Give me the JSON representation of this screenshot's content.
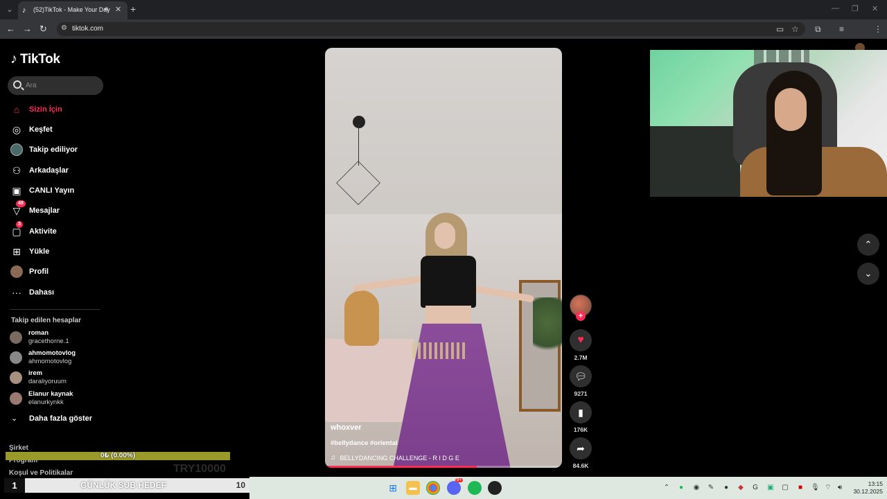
{
  "browser": {
    "tab_title": "(52)TikTok - Make Your Day",
    "url": "tiktok.com"
  },
  "sidebar": {
    "logo": "TikTok",
    "search_placeholder": "Ara",
    "nav": [
      {
        "label": "Sizin İçin",
        "icon": "home-icon",
        "active": true
      },
      {
        "label": "Keşfet",
        "icon": "compass-icon"
      },
      {
        "label": "Takip ediliyor",
        "icon": "following-avatar"
      },
      {
        "label": "Arkadaşlar",
        "icon": "friends-icon"
      },
      {
        "label": "CANLI Yayın",
        "icon": "live-icon"
      },
      {
        "label": "Mesajlar",
        "icon": "message-icon",
        "badge": "49"
      },
      {
        "label": "Aktivite",
        "icon": "activity-icon",
        "badge": "3"
      },
      {
        "label": "Yükle",
        "icon": "upload-icon"
      },
      {
        "label": "Profil",
        "icon": "profile-avatar"
      },
      {
        "label": "Dahası",
        "icon": "more-icon"
      }
    ],
    "following_title": "Takip edilen hesaplar",
    "following": [
      {
        "name": "roman",
        "username": "gracethorne.1"
      },
      {
        "name": "ahmomotovlog",
        "username": "ahmomotovlog"
      },
      {
        "name": "irem",
        "username": "daraliyoruum"
      },
      {
        "name": "Elanur kaynak",
        "username": "elanurkynkk"
      }
    ],
    "show_more": "Daha fazla göster",
    "footer": [
      "Şirket",
      "Program",
      "Koşul ve Politikalar"
    ]
  },
  "overlay": {
    "progress_text": "0₺ (0.00%)",
    "progress_fraction": 0.0,
    "ghost_amount": "TRY10000",
    "sub_goal_number": "1",
    "sub_goal_label": "GÜNLÜK SUB HEDEF",
    "sub_goal_target": "10"
  },
  "video": {
    "author": "whoxver",
    "hashtags": "#bellydance #oriental",
    "music": "BELLYDANCING CHALLENGE - R I D G E",
    "likes": "2.7M",
    "comments": "9271",
    "saves": "176K",
    "shares": "84.6K",
    "progress_fraction": 0.64
  },
  "taskbar": {
    "time": "13:15",
    "date": "30.12.2025",
    "discord_badge": "9+"
  },
  "colors": {
    "accent": "#fe2c55",
    "background": "#000000",
    "chrome": "#35363a"
  }
}
